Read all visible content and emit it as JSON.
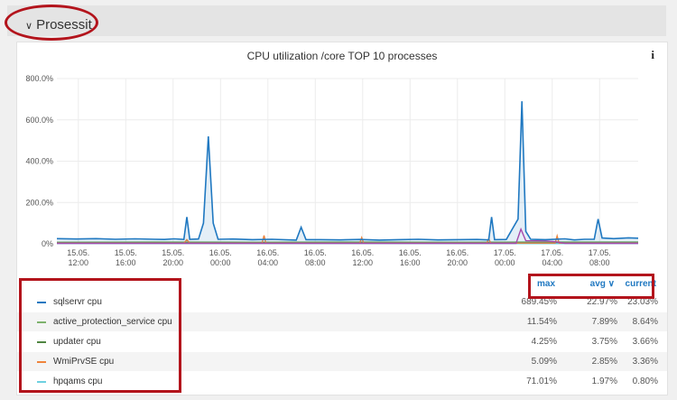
{
  "row": {
    "title": "Prosessit"
  },
  "panel": {
    "title": "CPU utilization /core TOP 10 processes",
    "info_icon": "i"
  },
  "legend": {
    "headers": {
      "max": "max",
      "avg": "avg",
      "avg_sort_icon": "∨",
      "current": "current"
    },
    "rows": [
      {
        "name": "sqlservr cpu",
        "color": "#1f78c1",
        "max": "689.45%",
        "avg": "22.97%",
        "current": "23.03%"
      },
      {
        "name": "active_protection_service cpu",
        "color": "#7eb26d",
        "max": "11.54%",
        "avg": "7.89%",
        "current": "8.64%"
      },
      {
        "name": "updater cpu",
        "color": "#508642",
        "max": "4.25%",
        "avg": "3.75%",
        "current": "3.66%"
      },
      {
        "name": "WmiPrvSE cpu",
        "color": "#ef843c",
        "max": "5.09%",
        "avg": "2.85%",
        "current": "3.36%"
      },
      {
        "name": "hpqams cpu",
        "color": "#6ed0e0",
        "max": "71.01%",
        "avg": "1.97%",
        "current": "0.80%"
      }
    ]
  },
  "chart_data": {
    "type": "line",
    "title": "CPU utilization /core TOP 10 processes",
    "y_ticks": [
      "800.0%",
      "600.0%",
      "400.0%",
      "200.0%",
      "0%"
    ],
    "ylim": [
      0,
      800
    ],
    "x_ticks": [
      [
        "15.05.",
        "12:00"
      ],
      [
        "15.05.",
        "16:00"
      ],
      [
        "15.05.",
        "20:00"
      ],
      [
        "16.05.",
        "00:00"
      ],
      [
        "16.05.",
        "04:00"
      ],
      [
        "16.05.",
        "08:00"
      ],
      [
        "16.05.",
        "12:00"
      ],
      [
        "16.05.",
        "16:00"
      ],
      [
        "16.05.",
        "20:00"
      ],
      [
        "17.05.",
        "00:00"
      ],
      [
        "17.05.",
        "04:00"
      ],
      [
        "17.05.",
        "08:00"
      ]
    ],
    "grid": true,
    "series": [
      {
        "name": "sqlservr cpu",
        "color": "#1f78c1",
        "points": [
          [
            0,
            25
          ],
          [
            2,
            23
          ],
          [
            4,
            25
          ],
          [
            6,
            22
          ],
          [
            8,
            24
          ],
          [
            10,
            22
          ],
          [
            11,
            21
          ],
          [
            12,
            24
          ],
          [
            13,
            21
          ],
          [
            13.3,
            130
          ],
          [
            13.6,
            22
          ],
          [
            14.5,
            23
          ],
          [
            15,
            100
          ],
          [
            15.5,
            520
          ],
          [
            16,
            100
          ],
          [
            16.5,
            22
          ],
          [
            18,
            23
          ],
          [
            20,
            20
          ],
          [
            22,
            22
          ],
          [
            24.5,
            18
          ],
          [
            25,
            80
          ],
          [
            25.5,
            20
          ],
          [
            27,
            20
          ],
          [
            29,
            19
          ],
          [
            31,
            21
          ],
          [
            33,
            18
          ],
          [
            35,
            20
          ],
          [
            37,
            22
          ],
          [
            39,
            19
          ],
          [
            41,
            20
          ],
          [
            43,
            21
          ],
          [
            44.2,
            19
          ],
          [
            44.5,
            130
          ],
          [
            44.8,
            20
          ],
          [
            46,
            21
          ],
          [
            47.2,
            120
          ],
          [
            47.6,
            690
          ],
          [
            48,
            60
          ],
          [
            48.5,
            22
          ],
          [
            50,
            20
          ],
          [
            52,
            24
          ],
          [
            53,
            19
          ],
          [
            54,
            22
          ],
          [
            55,
            22
          ],
          [
            55.4,
            120
          ],
          [
            55.8,
            28
          ],
          [
            57,
            25
          ],
          [
            58.5,
            29
          ],
          [
            59.5,
            27
          ]
        ]
      },
      {
        "name": "active_protection_service cpu",
        "color": "#7eb26d",
        "points": [
          [
            0,
            8
          ],
          [
            10,
            9
          ],
          [
            20,
            8
          ],
          [
            30,
            9
          ],
          [
            40,
            8
          ],
          [
            50,
            9
          ],
          [
            59.5,
            9
          ]
        ]
      },
      {
        "name": "updater cpu",
        "color": "#508642",
        "points": [
          [
            0,
            4
          ],
          [
            59.5,
            4
          ]
        ]
      },
      {
        "name": "WmiPrvSE cpu",
        "color": "#ef843c",
        "points": [
          [
            0,
            3
          ],
          [
            13,
            3
          ],
          [
            13.3,
            20
          ],
          [
            13.6,
            3
          ],
          [
            21,
            3
          ],
          [
            21.2,
            40
          ],
          [
            21.4,
            3
          ],
          [
            31,
            3
          ],
          [
            31.2,
            30
          ],
          [
            31.4,
            3
          ],
          [
            44,
            3
          ],
          [
            44.2,
            25
          ],
          [
            44.4,
            3
          ],
          [
            51,
            3
          ],
          [
            51.2,
            38
          ],
          [
            51.4,
            3
          ],
          [
            59.5,
            3
          ]
        ]
      },
      {
        "name": "hpqams cpu",
        "color": "#6ed0e0",
        "points": [
          [
            0,
            1
          ],
          [
            59.5,
            1
          ]
        ]
      },
      {
        "name": "",
        "color": "#ba43a9",
        "points": [
          [
            0,
            2
          ],
          [
            47,
            2
          ],
          [
            47.5,
            71
          ],
          [
            48,
            15
          ],
          [
            50,
            14
          ],
          [
            51,
            10
          ],
          [
            52,
            2
          ],
          [
            59.5,
            2
          ]
        ]
      }
    ]
  }
}
